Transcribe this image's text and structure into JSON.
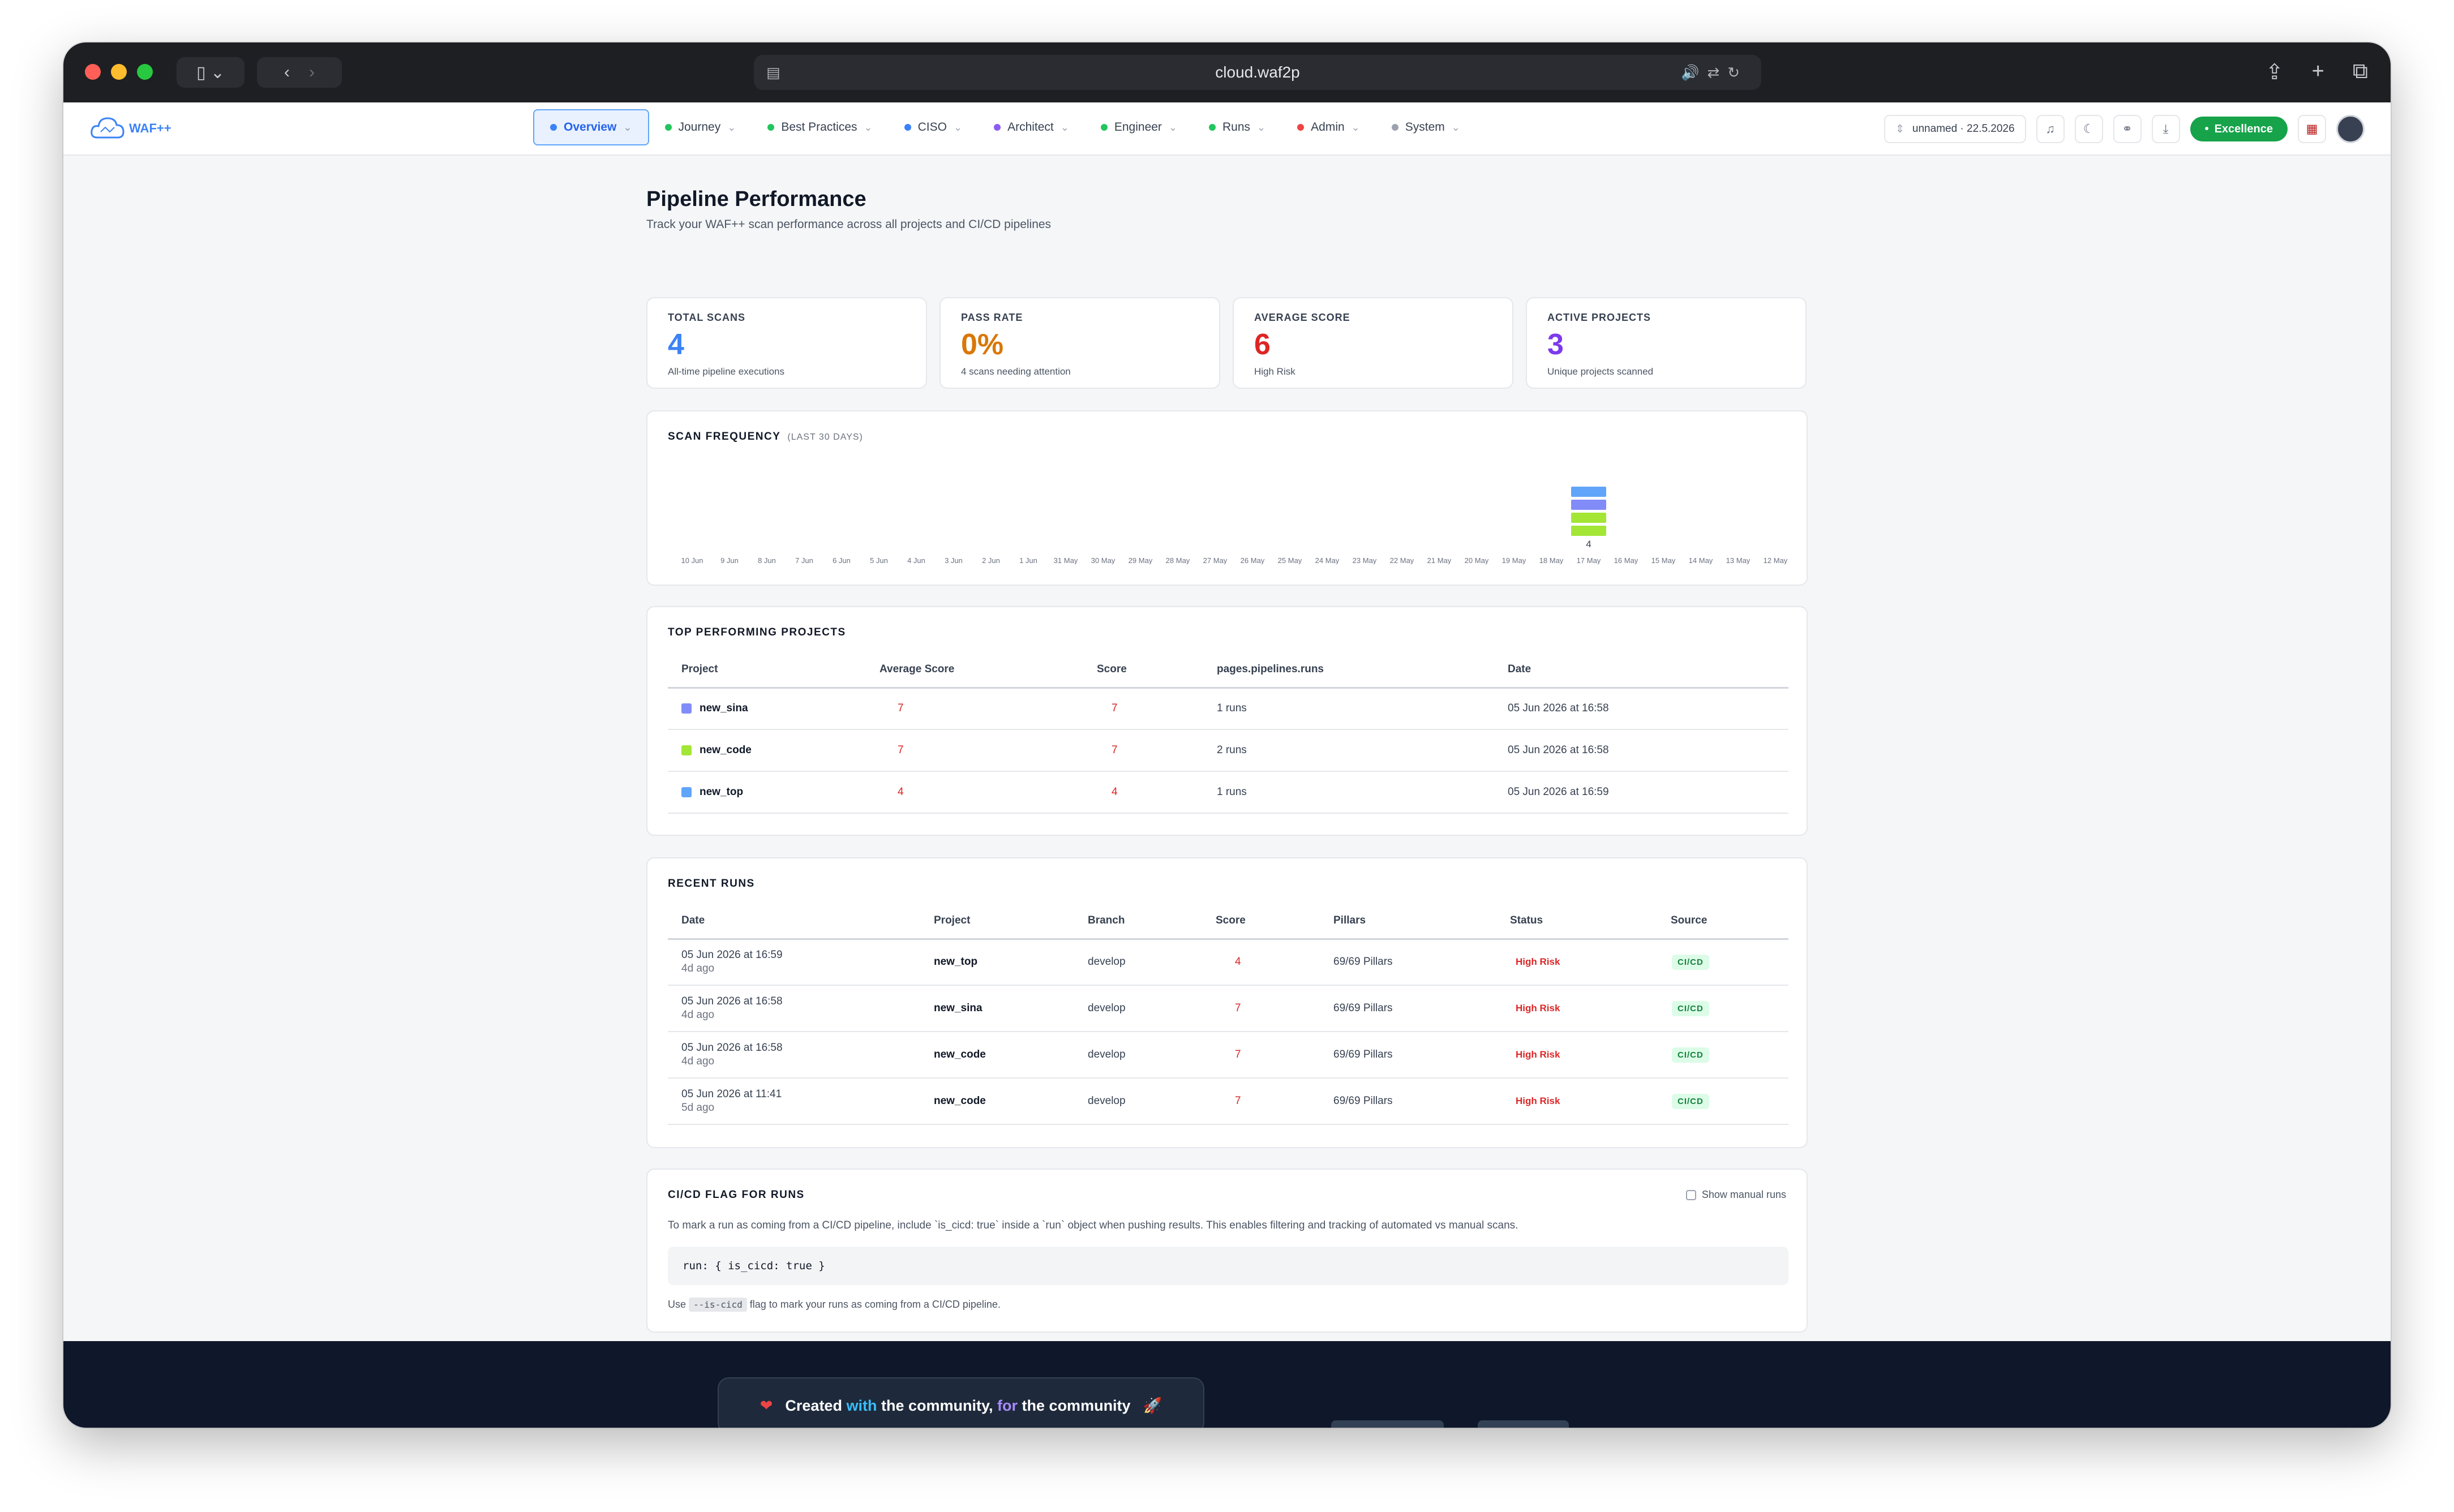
{
  "browser": {
    "url": "cloud.waf2p"
  },
  "app": {
    "logo_text": "WAF++",
    "nav": [
      {
        "label": "Overview",
        "color": "#3b82f6",
        "active": true
      },
      {
        "label": "Journey",
        "color": "#22c55e"
      },
      {
        "label": "Best Practices",
        "color": "#22c55e"
      },
      {
        "label": "CISO",
        "color": "#3b82f6"
      },
      {
        "label": "Architect",
        "color": "#8b5cf6"
      },
      {
        "label": "Engineer",
        "color": "#22c55e"
      },
      {
        "label": "Runs",
        "color": "#22c55e"
      },
      {
        "label": "Admin",
        "color": "#ef4444"
      },
      {
        "label": "System",
        "color": "#9ca3af"
      }
    ],
    "workspace": "unnamed · 22.5.2026",
    "excellence_label": "Excellence"
  },
  "page": {
    "title": "Pipeline Performance",
    "subtitle": "Track your WAF++ scan performance across all projects and CI/CD pipelines"
  },
  "stats": [
    {
      "label": "TOTAL SCANS",
      "value": "4",
      "sub": "All-time pipeline executions",
      "color": "#3b82f6"
    },
    {
      "label": "PASS RATE",
      "value": "0%",
      "sub": "4 scans needing attention",
      "color": "#d97706"
    },
    {
      "label": "AVERAGE SCORE",
      "value": "6",
      "sub": "High Risk",
      "color": "#dc2626"
    },
    {
      "label": "ACTIVE PROJECTS",
      "value": "3",
      "sub": "Unique projects scanned",
      "color": "#7c3aed"
    }
  ],
  "scan_frequency": {
    "title": "SCAN FREQUENCY",
    "range": "(LAST 30 DAYS)"
  },
  "chart_data": {
    "type": "bar",
    "categories": [
      "10 Jun",
      "9 Jun",
      "8 Jun",
      "7 Jun",
      "6 Jun",
      "5 Jun",
      "4 Jun",
      "3 Jun",
      "2 Jun",
      "1 Jun",
      "31 May",
      "30 May",
      "29 May",
      "28 May",
      "27 May",
      "26 May",
      "25 May",
      "24 May",
      "23 May",
      "22 May",
      "21 May",
      "20 May",
      "19 May",
      "18 May",
      "17 May",
      "16 May",
      "15 May",
      "14 May",
      "13 May",
      "12 May"
    ],
    "values": [
      0,
      0,
      0,
      0,
      0,
      0,
      0,
      0,
      0,
      0,
      0,
      0,
      0,
      0,
      0,
      0,
      0,
      0,
      0,
      0,
      0,
      0,
      0,
      0,
      4,
      0,
      0,
      0,
      0,
      0
    ],
    "stack_colors": [
      "#a3e635",
      "#a3e635",
      "#818cf8",
      "#60a5fa"
    ],
    "value_label": "4"
  },
  "top_projects": {
    "title": "TOP PERFORMING PROJECTS",
    "columns": [
      "Project",
      "Average Score",
      "Score",
      "pages.pipelines.runs",
      "Date"
    ],
    "rows": [
      {
        "name": "new_sina",
        "color": "#818cf8",
        "avg": "7",
        "score": "7",
        "runs": "1 runs",
        "date": "05 Jun 2026 at 16:58"
      },
      {
        "name": "new_code",
        "color": "#a3e635",
        "avg": "7",
        "score": "7",
        "runs": "2 runs",
        "date": "05 Jun 2026 at 16:58"
      },
      {
        "name": "new_top",
        "color": "#60a5fa",
        "avg": "4",
        "score": "4",
        "runs": "1 runs",
        "date": "05 Jun 2026 at 16:59"
      }
    ]
  },
  "recent_runs": {
    "title": "RECENT RUNS",
    "columns": [
      "Date",
      "Project",
      "Branch",
      "Score",
      "Pillars",
      "Status",
      "Source"
    ],
    "rows": [
      {
        "date": "05 Jun 2026 at 16:59",
        "ago": "4d ago",
        "project": "new_top",
        "branch": "develop",
        "score": "4",
        "pillars": "69/69 Pillars",
        "status": "High Risk",
        "source": "CI/CD"
      },
      {
        "date": "05 Jun 2026 at 16:58",
        "ago": "4d ago",
        "project": "new_sina",
        "branch": "develop",
        "score": "7",
        "pillars": "69/69 Pillars",
        "status": "High Risk",
        "source": "CI/CD"
      },
      {
        "date": "05 Jun 2026 at 16:58",
        "ago": "4d ago",
        "project": "new_code",
        "branch": "develop",
        "score": "7",
        "pillars": "69/69 Pillars",
        "status": "High Risk",
        "source": "CI/CD"
      },
      {
        "date": "05 Jun 2026 at 11:41",
        "ago": "5d ago",
        "project": "new_code",
        "branch": "develop",
        "score": "7",
        "pillars": "69/69 Pillars",
        "status": "High Risk",
        "source": "CI/CD"
      }
    ]
  },
  "cicd": {
    "title": "CI/CD FLAG FOR RUNS",
    "show_manual": "Show manual runs",
    "description": "To mark a run as coming from a CI/CD pipeline, include `is_cicd: true` inside a `run` object when pushing results. This enables filtering and tracking of automated vs manual scans.",
    "code": "run: { is_cicd: true }",
    "use_prefix": "Use",
    "use_flag": "--is-cicd",
    "use_suffix": "flag to mark your runs as coming from a CI/CD pipeline."
  },
  "footer": {
    "part1": "Created",
    "part2": "with",
    "part3": "the community,",
    "part4": "for",
    "part5": "the community"
  }
}
